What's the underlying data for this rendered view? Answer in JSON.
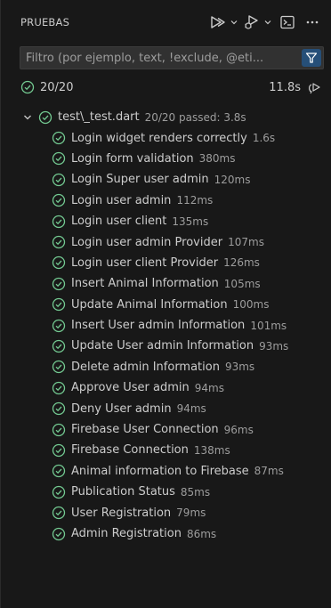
{
  "header": {
    "title": "PRUEBAS"
  },
  "filter": {
    "placeholder": "Filtro (por ejemplo, text, !exclude, @eti..."
  },
  "summary": {
    "count": "20/20",
    "duration": "11.8s"
  },
  "colors": {
    "pass": "#73c991",
    "accent_button": "#264f78"
  },
  "suite": {
    "label": "test\\_test.dart",
    "meta": "20/20 passed: 3.8s"
  },
  "tests": [
    {
      "label": "Login widget renders correctly",
      "meta": "1.6s"
    },
    {
      "label": "Login form validation",
      "meta": "380ms"
    },
    {
      "label": "Login Super user admin",
      "meta": "120ms"
    },
    {
      "label": "Login user admin",
      "meta": "112ms"
    },
    {
      "label": "Login user client",
      "meta": "135ms"
    },
    {
      "label": "Login user admin Provider",
      "meta": "107ms"
    },
    {
      "label": "Login user client Provider",
      "meta": "126ms"
    },
    {
      "label": "Insert Animal Information",
      "meta": "105ms"
    },
    {
      "label": "Update Animal Information",
      "meta": "100ms"
    },
    {
      "label": "Insert User admin Information",
      "meta": "101ms"
    },
    {
      "label": "Update User admin Information",
      "meta": "93ms"
    },
    {
      "label": "Delete admin Information",
      "meta": "93ms"
    },
    {
      "label": "Approve User admin",
      "meta": "94ms"
    },
    {
      "label": "Deny User admin",
      "meta": "94ms"
    },
    {
      "label": "Firebase User Connection",
      "meta": "96ms"
    },
    {
      "label": "Firebase Connection",
      "meta": "138ms"
    },
    {
      "label": "Animal information to Firebase",
      "meta": "87ms"
    },
    {
      "label": "Publication Status",
      "meta": "85ms"
    },
    {
      "label": "User Registration",
      "meta": "79ms"
    },
    {
      "label": "Admin Registration",
      "meta": "86ms"
    }
  ]
}
